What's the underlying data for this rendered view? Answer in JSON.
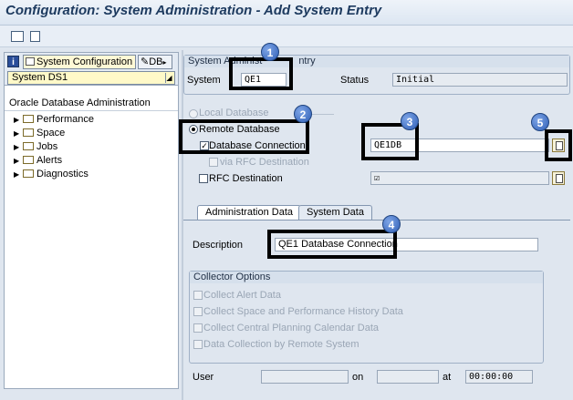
{
  "window": {
    "title": "Configuration: System Administration - Add System Entry"
  },
  "toolbar": {
    "icons": [
      "table-icon",
      "new-document-icon"
    ]
  },
  "left": {
    "tab_system_configuration": "System Configuration",
    "tab_db": "DB",
    "system_selector": "System DS1",
    "tree_title": "Oracle Database Administration",
    "tree_items": [
      "Performance",
      "Space",
      "Jobs",
      "Alerts",
      "Diagnostics"
    ]
  },
  "system_admin": {
    "group_title": "System Administ",
    "group_title_tail": "ntry",
    "system_label": "System",
    "system_value": "QE1",
    "status_label": "Status",
    "status_value": "Initial"
  },
  "connection": {
    "local_database": "Local Database",
    "remote_database": "Remote Database",
    "database_connection": "Database Connection",
    "database_connection_value": "QE1DB",
    "via_rfc": "via RFC Destination",
    "rfc_destination": "RFC Destination",
    "rfc_value_checkmark": "☑"
  },
  "tabs": {
    "administration_data": "Administration Data",
    "system_data": "System Data"
  },
  "admin_data": {
    "description_label": "Description",
    "description_value": "QE1 Database Connection",
    "collector_title": "Collector Options",
    "collect_alert": "Collect Alert Data",
    "collect_space": "Collect Space and Performance History Data",
    "collect_ccp": "Collect Central Planning Calendar Data",
    "collect_remote": "Data Collection by Remote System",
    "user_label": "User",
    "on_label": "on",
    "at_label": "at",
    "at_value": "00:00:00"
  },
  "callouts": [
    "1",
    "2",
    "3",
    "4",
    "5"
  ]
}
